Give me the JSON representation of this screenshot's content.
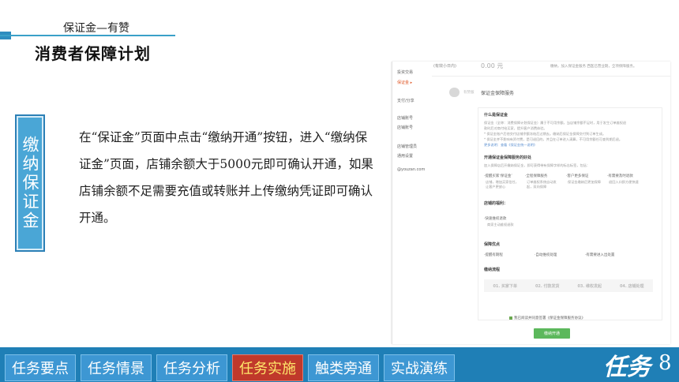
{
  "slide": {
    "subtitle": "保证金—有赞",
    "title": "消费者保障计划",
    "vertical_title": "缴纳保证金",
    "body": "在“保证金”页面中点击“缴纳开通”按钮，进入“缴纳保证金”页面，店铺余额大于5000元即可确认开通，如果店铺余额不足需要充值或转账并上传缴纳凭证即可确认开通。"
  },
  "screenshot": {
    "nav_items": [
      {
        "label": "投资交易"
      },
      {
        "label": "保证金 ▸"
      },
      {
        "label": "支付/分享"
      },
      {
        "label": "店铺账号"
      },
      {
        "label": "店铺账号"
      },
      {
        "label": "店铺管理员"
      },
      {
        "label": "通用设置"
      },
      {
        "label": "@youzan.com"
      }
    ],
    "header_label": "(有效小日内)",
    "amount": "0.00 元",
    "header_note": "缴纳，加入保证金服务   西医已营业期，全项保障服务。",
    "logo_text": "有赞服",
    "service_title": "保证金保障服务",
    "section1_title": "什么是保证金",
    "section1_lines": [
      "保证金（全称：消费保障计划保证金）属于不可用余额，当店铺余额不足时，用于发生订单维权退",
      "款时后对商付给买家，提升客户消费体验。",
      "* 保证金账户后他交付店铺余额冻结后过期去。缴纳后保证金保障交付到订单生成。",
      "* 保证金并不影响有资付费，是可退回的，并且在订单进入清算，不可用余额任可查到期后退。",
      "更多说明：查看《保证金统一说明》"
    ],
    "section2_title": "开通保证金保障服务的好处",
    "section2_intro": "加入保障店后开缴纳保证金，即可获得带有保障字样的标志标签，包括：",
    "benefits": [
      "·提醒买家‘保证金’",
      "·全程保障服务",
      "·客户更多保证",
      "·有需要及时退款"
    ],
    "benefit_notes": [
      "店铺，增加买家信任，让客户更放心",
      "订单维权系统自动发起，双向保障",
      "保证金缴纳后更加保障",
      "退回入口即方便快速"
    ],
    "section3_title": "店铺的福利：",
    "section3_item": "·快速维权退款",
    "section3_note": "商家主动维权退款",
    "section4_title": "保障优点",
    "section4_items": [
      "·提醒有期程",
      "·自动维权处理",
      "·有需要进入出处置"
    ],
    "section5_title": "缴纳流程",
    "steps": [
      "01. 买家下单",
      "02. 付款发货",
      "03. 维权发起",
      "04. 店铺处理"
    ],
    "agree_text": "我已阅读并同意签署《保证金保障服务协议》",
    "pay_button": "缴纳开通"
  },
  "tabs": [
    {
      "label": "任务要点"
    },
    {
      "label": "任务情景"
    },
    {
      "label": "任务分析"
    },
    {
      "label": "任务实施",
      "active": true
    },
    {
      "label": "触类旁通"
    },
    {
      "label": "实战演练"
    }
  ],
  "task_badge": {
    "word": "任务",
    "number": "8"
  },
  "colors": {
    "bottom_bar": "#1f7fb6",
    "tab": "#3d97d3",
    "active_tab": "#c0392b",
    "active_tab_text": "#ffe86b",
    "side_box": "#4aa6d6"
  }
}
